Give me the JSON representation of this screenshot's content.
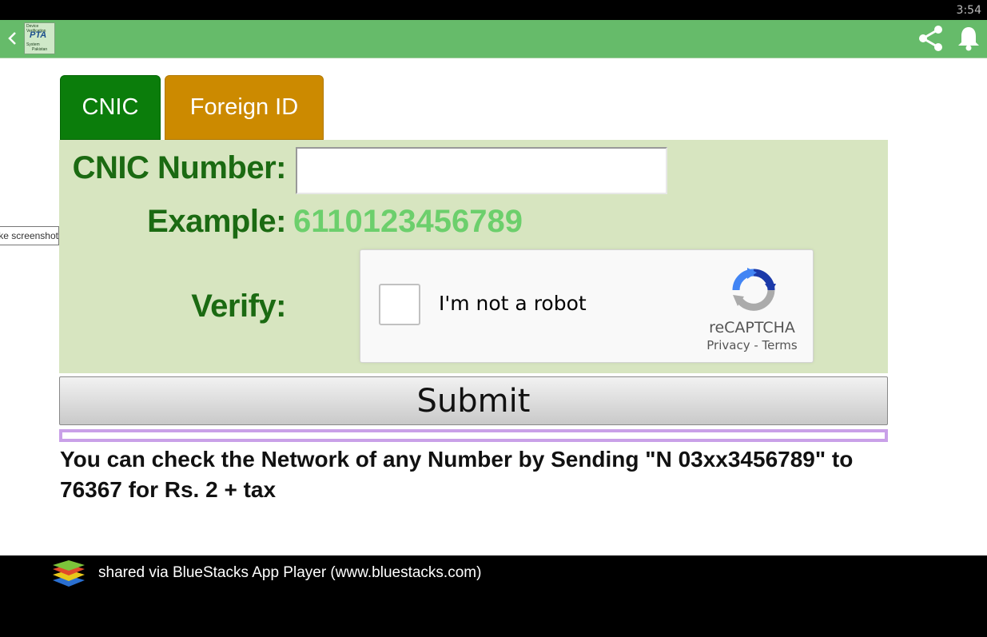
{
  "status_bar": {
    "time": "3:54"
  },
  "app_bar": {
    "back_icon": "chevron-left-icon",
    "logo_lines": [
      "Device",
      "Verification",
      "PTA",
      "System",
      "Pakistan"
    ],
    "share_icon": "share-icon",
    "notification_icon": "bell-icon",
    "color": "#66bb6a"
  },
  "tabs": [
    {
      "label": "CNIC",
      "color": "#0b7d0b",
      "selected": true
    },
    {
      "label": "Foreign ID",
      "color": "#cc8a00",
      "selected": false
    }
  ],
  "form": {
    "cnic_label": "CNIC Number:",
    "cnic_value": "",
    "example_label": "Example:",
    "example_value": "6110123456789",
    "verify_label": "Verify:"
  },
  "recaptcha": {
    "checkbox_label": "I'm not a robot",
    "brand": "reCAPTCHA",
    "privacy": "Privacy",
    "separator": " - ",
    "terms": "Terms"
  },
  "submit_label": "Submit",
  "info_text": "You can check the Network of any Number by Sending \"N 03xx3456789\" to 76367 for Rs. 2 + tax",
  "tooltip": "Take screenshot",
  "footer": {
    "text": "shared via BlueStacks App Player (www.bluestacks.com)"
  }
}
